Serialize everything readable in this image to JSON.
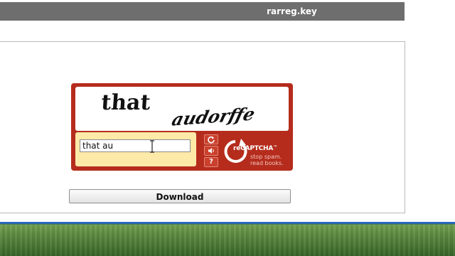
{
  "panel": {
    "title": "rarreg.key"
  },
  "captcha": {
    "challenge_words": [
      "that",
      "audorffe"
    ],
    "answer_value": "that au",
    "controls": {
      "reload_icon": "refresh-icon",
      "audio_icon": "speaker-icon",
      "help_icon": "help-icon",
      "help_glyph": "?"
    },
    "brand": "reCAPTCHA",
    "trademark": "™",
    "tagline_line1": "stop spam.",
    "tagline_line2": "read books.",
    "colors": {
      "frame": "#b52c1d",
      "answer_bg": "#fde9a8"
    }
  },
  "download": {
    "label": "Download"
  }
}
